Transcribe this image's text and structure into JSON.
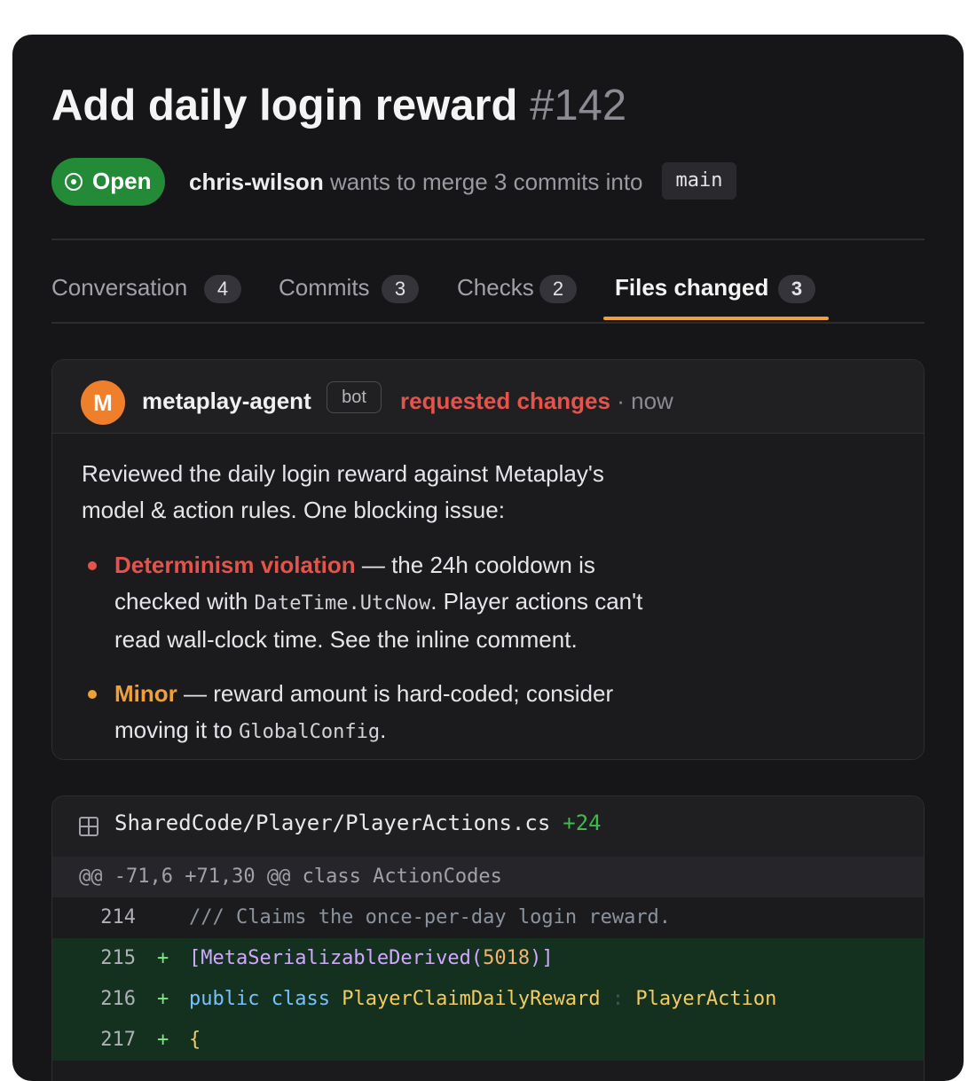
{
  "pr": {
    "title": "Add daily login reward",
    "number": "#142",
    "state": "Open",
    "author": "chris-wilson",
    "merge_text": "wants to merge 3 commits into",
    "base_branch": "main"
  },
  "tabs": [
    {
      "label": "Conversation",
      "count": "4",
      "active": false
    },
    {
      "label": "Commits",
      "count": "3",
      "active": false
    },
    {
      "label": "Checks",
      "count": "2",
      "active": false
    },
    {
      "label": "Files changed",
      "count": "3",
      "active": true
    }
  ],
  "review": {
    "avatar_letter": "M",
    "reviewer": "metaplay-agent",
    "tag": "bot",
    "status": "requested changes",
    "separator": "·",
    "time": "now",
    "summary": "Reviewed the daily login reward against Metaplay's model & action rules. One blocking issue:",
    "bullets": [
      {
        "title": "Determinism violation",
        "text1": " — the 24h cooldown is checked with ",
        "code": "DateTime.UtcNow",
        "text2": ". Player actions can't read wall-clock time. See the inline comment."
      },
      {
        "title": "Minor",
        "text1": " — reward amount is hard-coded; consider moving it to ",
        "code": "GlobalConfig",
        "text2": "."
      }
    ]
  },
  "diff": {
    "icon": "file-diff-icon",
    "file_path": "SharedCode/Player/PlayerActions.cs",
    "additions": "+24",
    "hunk_header": "@@ -71,6 +71,30 @@ class ActionCodes",
    "lines": [
      {
        "num": "214",
        "sign": "",
        "comment": "/// Claims the once-per-day login reward."
      },
      {
        "num": "215",
        "sign": "+",
        "attr_open": "[MetaSerializableDerived(",
        "attr_num": "5018",
        "attr_close": ")]"
      },
      {
        "num": "216",
        "sign": "+",
        "kw1": "public",
        "kw2": "class",
        "type": "PlayerClaimDailyReward",
        "colon": ":",
        "base": "PlayerAction"
      },
      {
        "num": "217",
        "sign": "+",
        "plain": "{"
      }
    ]
  },
  "colors": {
    "open_green": "#238a37",
    "tab_accent": "#f0a038",
    "changes_red": "#e5534b",
    "minor_amber": "#f0a038",
    "added_bg": "#14301f"
  }
}
